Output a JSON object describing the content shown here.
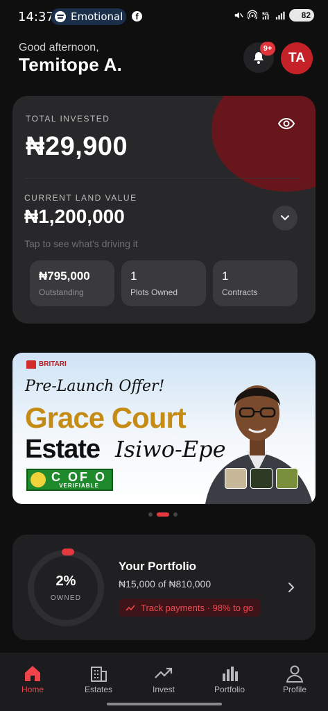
{
  "status_bar": {
    "time": "14:37",
    "now_playing": "Emotional",
    "battery": "82",
    "icons": [
      "spotify-icon",
      "facebook-icon",
      "mute-icon",
      "hotspot-icon",
      "signal-5g-icon",
      "signal-bars-icon",
      "battery-icon"
    ]
  },
  "header": {
    "greeting": "Good afternoon,",
    "name": "Temitope A.",
    "notification_badge": "9+",
    "avatar_initials": "TA"
  },
  "investment_card": {
    "total_label": "TOTAL INVESTED",
    "total_value": "₦29,900",
    "land_label": "CURRENT LAND VALUE",
    "land_value": "₦1,200,000",
    "hint": "Tap to see what's driving it",
    "stats": [
      {
        "value": "₦795,000",
        "label": "Outstanding"
      },
      {
        "value": "1",
        "label": "Plots Owned"
      },
      {
        "value": "1",
        "label": "Contracts"
      }
    ]
  },
  "banner": {
    "brand": "BRITARI",
    "offer": "Pre-Launch Offer!",
    "title_line1": "Grace Court",
    "title_line2": "Estate",
    "title_line3": "Isiwo-Epe",
    "badge_main": "C OF O",
    "badge_sub": "VERIFIABLE"
  },
  "carousel": {
    "count": 3,
    "active_index": 1
  },
  "portfolio": {
    "percent": "2%",
    "percent_caption": "OWNED",
    "progress_fraction": 0.02,
    "title": "Your Portfolio",
    "amount": "₦15,000 of ₦810,000",
    "track_label": "Track payments · 98% to go"
  },
  "nav": {
    "items": [
      {
        "label": "Home",
        "icon": "home-icon",
        "active": true
      },
      {
        "label": "Estates",
        "icon": "estates-icon",
        "active": false
      },
      {
        "label": "Invest",
        "icon": "invest-icon",
        "active": false
      },
      {
        "label": "Portfolio",
        "icon": "portfolio-icon",
        "active": false
      },
      {
        "label": "Profile",
        "icon": "profile-icon",
        "active": false
      }
    ]
  },
  "colors": {
    "accent": "#e53940",
    "background": "#0f0f10",
    "card": "#28282a"
  }
}
